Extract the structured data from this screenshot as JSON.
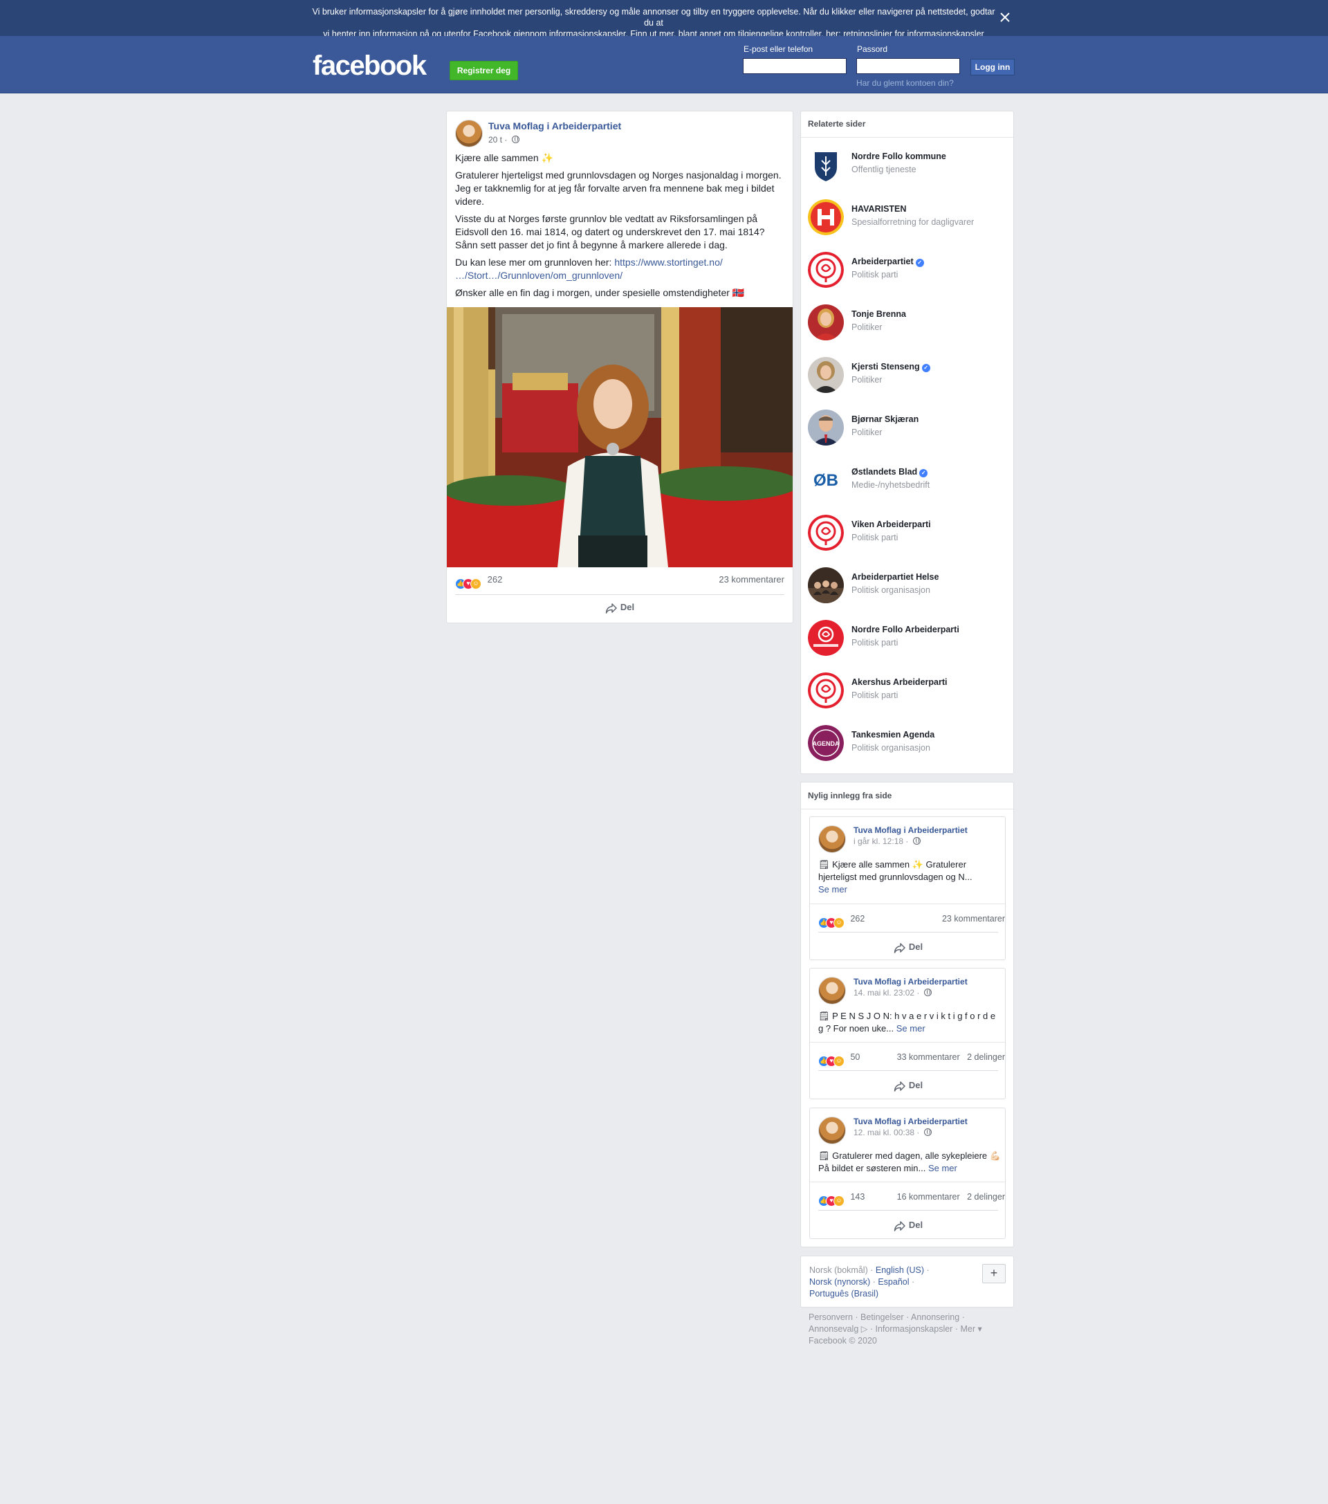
{
  "cookie": {
    "text_line1": "Vi bruker informasjonskapsler for å gjøre innholdet mer personlig, skreddersy og måle annonser og tilby en tryggere opplevelse. Når du klikker eller navigerer på nettstedet, godtar du at",
    "text_line2": "vi henter inn informasjon på og utenfor Facebook gjennom informasjonskapsler. Finn ut mer, blant annet om tilgjengelige kontroller, her: ",
    "link": "retningslinjer for informasjonskapsler"
  },
  "header": {
    "logo": "facebook",
    "register": "Registrer deg",
    "email_label": "E-post eller telefon",
    "password_label": "Passord",
    "login": "Logg inn",
    "forgot": "Har du glemt kontoen din?"
  },
  "post": {
    "author": "Tuva Moflag i Arbeiderpartiet",
    "time": "20 t · ",
    "p1": "Kjære alle sammen ✨",
    "p2": "Gratulerer hjerteligst med grunnlovsdagen og Norges nasjonaldag i morgen. Jeg er takknemlig for at jeg får forvalte arven fra mennene bak meg i bildet videre.",
    "p3": "Visste du at Norges første grunnlov ble vedtatt av Riksforsamlingen på Eidsvoll den 16. mai 1814, og datert og underskrevet den 17. mai 1814? Sånn sett passer det jo fint å begynne å markere allerede i dag.",
    "p4_text": "Du kan lese mer om grunnloven her: ",
    "p4_link1": "https://www.stortinget.no/",
    "p4_link2": "…/Stort…/Grunnloven/om_grunnloven/",
    "p5": "Ønsker alle en fin dag i morgen, under spesielle omstendigheter 🇳🇴",
    "reactions": "262",
    "comments": "23 kommentarer",
    "share": "Del"
  },
  "related": {
    "title": "Relaterte sider",
    "items": [
      {
        "name": "Nordre Follo kommune",
        "category": "Offentlig tjeneste",
        "verified": false
      },
      {
        "name": "HAVARISTEN",
        "category": "Spesialforretning for dagligvarer",
        "verified": false
      },
      {
        "name": "Arbeiderpartiet",
        "category": "Politisk parti",
        "verified": true
      },
      {
        "name": "Tonje Brenna",
        "category": "Politiker",
        "verified": false
      },
      {
        "name": "Kjersti Stenseng",
        "category": "Politiker",
        "verified": true
      },
      {
        "name": "Bjørnar Skjæran",
        "category": "Politiker",
        "verified": false
      },
      {
        "name": "Østlandets Blad",
        "category": "Medie-/nyhetsbedrift",
        "verified": true
      },
      {
        "name": "Viken Arbeiderparti",
        "category": "Politisk parti",
        "verified": false
      },
      {
        "name": "Arbeiderpartiet Helse",
        "category": "Politisk organisasjon",
        "verified": false
      },
      {
        "name": "Nordre Follo Arbeiderparti",
        "category": "Politisk parti",
        "verified": false
      },
      {
        "name": "Akershus Arbeiderparti",
        "category": "Politisk parti",
        "verified": false
      },
      {
        "name": "Tankesmien Agenda",
        "category": "Politisk organisasjon",
        "verified": false
      }
    ]
  },
  "recent": {
    "title": "Nylig innlegg fra side",
    "posts": [
      {
        "author": "Tuva Moflag i Arbeiderpartiet",
        "time": "i går kl. 12:18 · ",
        "text": "🗒 Kjære alle sammen ✨ Gratulerer hjerteligst med grunnlovsdagen og N...",
        "more": "Se mer",
        "reactions": "262",
        "stats": "23 kommentarer",
        "share": "Del"
      },
      {
        "author": "Tuva Moflag i Arbeiderpartiet",
        "time": "14. mai kl. 23:02 · ",
        "text": "🗒 P E N S J O N: h v a e r v i k t i g f o r d e g ? For noen uke...",
        "more": "Se mer",
        "reactions": "50",
        "stats": "33 kommentarer   2 delinger",
        "share": "Del"
      },
      {
        "author": "Tuva Moflag i Arbeiderpartiet",
        "time": "12. mai kl. 00:38 · ",
        "text": "🗒 Gratulerer med dagen, alle sykepleiere 💪🏻 På bildet er søsteren min...",
        "more": "Se mer",
        "reactions": "143",
        "stats": "16 kommentarer   2 delinger",
        "share": "Del"
      }
    ]
  },
  "languages": {
    "current": "Norsk (bokmål)",
    "options": [
      "English (US)",
      "Norsk (nynorsk)",
      "Español",
      "Português (Brasil)"
    ]
  },
  "footer": {
    "links": [
      "Personvern",
      "Betingelser",
      "Annonsering",
      "Annonsevalg ▷",
      "Informasjonskapsler",
      "Mer ▾"
    ],
    "copyright": "Facebook © 2020"
  }
}
